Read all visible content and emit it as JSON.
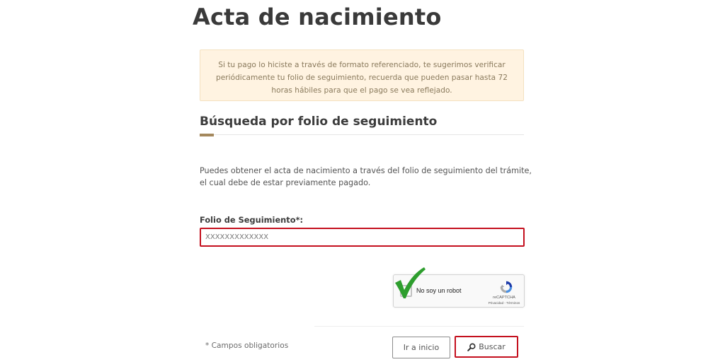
{
  "page": {
    "title": "Acta de nacimiento"
  },
  "notice": {
    "text": "Si tu pago lo hiciste a través de formato referenciado, te sugerimos verificar periódicamente tu folio de seguimiento, recuerda que pueden pasar hasta 72 horas hábiles para que el pago se vea reflejado."
  },
  "search_section": {
    "title": "Búsqueda por folio de seguimiento",
    "description": "Puedes obtener el acta de nacimiento a través del folio de seguimiento del trámite, el cual debe de estar previamente pagado."
  },
  "form": {
    "folio_label": "Folio de Seguimiento*:",
    "folio_value": "XXXXXXXXXXXXX",
    "required_note": "* Campos obligatorios"
  },
  "recaptcha": {
    "label": "No soy un robot",
    "brand": "reCAPTCHA",
    "terms": "Privacidad - Términos",
    "logo_icon": "recaptcha-logo-icon",
    "checkmark_icon": "checkmark-icon"
  },
  "buttons": {
    "home_label": "Ir a inicio",
    "search_label": "Buscar",
    "search_icon": "search-icon"
  },
  "colors": {
    "accent_gold": "#a4885d",
    "notice_bg": "#fff3e1",
    "highlight_red": "#c4101e",
    "check_green": "#2e9e2e"
  }
}
